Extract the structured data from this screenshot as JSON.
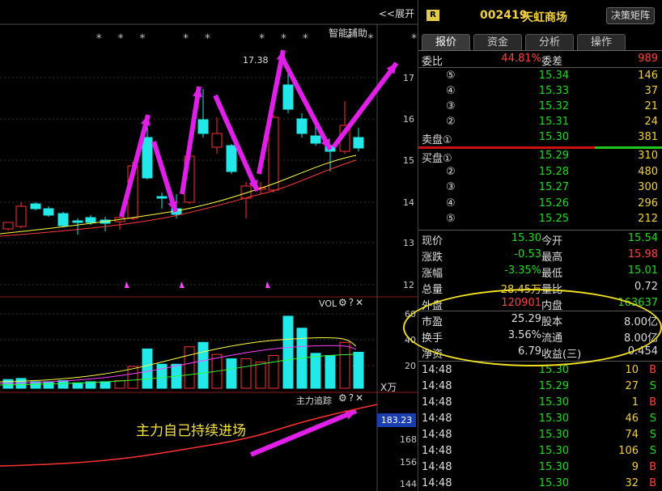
{
  "chart": {
    "expand_label": "<<展开",
    "smart_assist_label": "智能辅助",
    "stars": "* * *   * *    * * *   * *   *",
    "high_label": "17.38",
    "price_axis": [
      "17",
      "16",
      "15",
      "14",
      "13",
      "12"
    ],
    "vol_panel": {
      "title": "VOL",
      "axis": [
        "60",
        "40",
        "20"
      ],
      "unit": "X万"
    },
    "track_panel": {
      "title": "主力追踪",
      "axis": [
        "168",
        "156",
        "144"
      ],
      "current_value": "183.23"
    },
    "annotation": "主力自己持续进场",
    "icons": {
      "settings": "gear-icon",
      "help": "question-icon",
      "close": "close-icon"
    }
  },
  "quote": {
    "badge": "R",
    "code": "002419",
    "name": "天虹商场",
    "decision_button": "决策矩阵",
    "tabs": [
      "报价",
      "资金",
      "分析",
      "操作"
    ],
    "weibi": {
      "label": "委比",
      "value": "44.81%",
      "diff_label": "委差",
      "diff_value": "989"
    },
    "asks": [
      {
        "level": "⑤",
        "price": "15.34",
        "volume": "146"
      },
      {
        "level": "④",
        "price": "15.33",
        "volume": "37"
      },
      {
        "level": "③",
        "price": "15.32",
        "volume": "21"
      },
      {
        "level": "②",
        "price": "15.31",
        "volume": "24"
      },
      {
        "level": "卖盘①",
        "price": "15.30",
        "volume": "381"
      }
    ],
    "bids": [
      {
        "level": "买盘①",
        "price": "15.29",
        "volume": "310"
      },
      {
        "level": "②",
        "price": "15.28",
        "volume": "480"
      },
      {
        "level": "③",
        "price": "15.27",
        "volume": "300"
      },
      {
        "level": "④",
        "price": "15.26",
        "volume": "296"
      },
      {
        "level": "⑤",
        "price": "15.25",
        "volume": "212"
      }
    ],
    "stats": [
      {
        "l1": "现价",
        "v1": "15.30",
        "c1": "green",
        "l2": "今开",
        "v2": "15.54",
        "c2": "green"
      },
      {
        "l1": "涨跌",
        "v1": "-0.53",
        "c1": "green",
        "l2": "最高",
        "v2": "15.98",
        "c2": "red"
      },
      {
        "l1": "涨幅",
        "v1": "-3.35%",
        "c1": "green",
        "l2": "最低",
        "v2": "15.01",
        "c2": "green"
      },
      {
        "l1": "总量",
        "v1": "28.45万",
        "c1": "yellow",
        "l2": "量比",
        "v2": "0.72",
        "c2": "white"
      },
      {
        "l1": "外盘",
        "v1": "120901",
        "c1": "red",
        "l2": "内盘",
        "v2": "163637",
        "c2": "green"
      }
    ],
    "fundamentals": [
      {
        "l1": "市盈",
        "v1": "25.29",
        "l2": "股本",
        "v2": "8.00亿"
      },
      {
        "l1": "换手",
        "v1": "3.56%",
        "l2": "流通",
        "v2": "8.00亿"
      },
      {
        "l1": "净资",
        "v1": "6.79",
        "l2": "收益(三)",
        "v2": "0.454"
      }
    ],
    "ticks": [
      {
        "time": "14:48",
        "price": "15.30",
        "pc": "green",
        "vol": "10",
        "side": "B"
      },
      {
        "time": "14:48",
        "price": "15.29",
        "pc": "green",
        "vol": "27",
        "side": "S"
      },
      {
        "time": "14:48",
        "price": "15.30",
        "pc": "green",
        "vol": "1",
        "side": "B"
      },
      {
        "time": "14:48",
        "price": "15.30",
        "pc": "green",
        "vol": "46",
        "side": "S"
      },
      {
        "time": "14:48",
        "price": "15.30",
        "pc": "green",
        "vol": "74",
        "side": "S"
      },
      {
        "time": "14:48",
        "price": "15.30",
        "pc": "green",
        "vol": "106",
        "side": "S"
      },
      {
        "time": "14:48",
        "price": "15.30",
        "pc": "green",
        "vol": "9",
        "side": "B"
      },
      {
        "time": "14:48",
        "price": "15.30",
        "pc": "green",
        "vol": "32",
        "side": "B"
      }
    ]
  }
}
